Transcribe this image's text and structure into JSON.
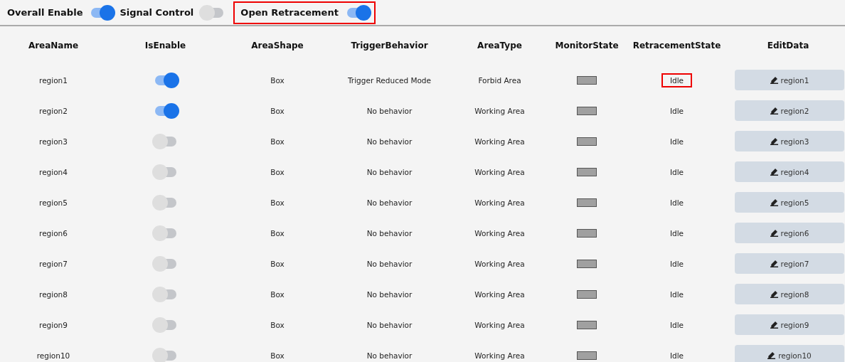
{
  "toolbar": [
    {
      "label": "Overall Enable",
      "on": true,
      "highlighted": false
    },
    {
      "label": "Signal Control",
      "on": false,
      "highlighted": false
    },
    {
      "label": "Open Retracement",
      "on": true,
      "highlighted": true
    }
  ],
  "table": {
    "columns": [
      "AreaName",
      "IsEnable",
      "AreaShape",
      "TriggerBehavior",
      "AreaType",
      "MonitorState",
      "RetracementState",
      "EditData"
    ],
    "rows": [
      {
        "name": "region1",
        "enabled": true,
        "shape": "Box",
        "trigger": "Trigger Reduced Mode",
        "type": "Forbid Area",
        "retracement": "Idle",
        "highlighted": true,
        "edit": "region1"
      },
      {
        "name": "region2",
        "enabled": true,
        "shape": "Box",
        "trigger": "No behavior",
        "type": "Working Area",
        "retracement": "Idle",
        "highlighted": false,
        "edit": "region2"
      },
      {
        "name": "region3",
        "enabled": false,
        "shape": "Box",
        "trigger": "No behavior",
        "type": "Working Area",
        "retracement": "Idle",
        "highlighted": false,
        "edit": "region3"
      },
      {
        "name": "region4",
        "enabled": false,
        "shape": "Box",
        "trigger": "No behavior",
        "type": "Working Area",
        "retracement": "Idle",
        "highlighted": false,
        "edit": "region4"
      },
      {
        "name": "region5",
        "enabled": false,
        "shape": "Box",
        "trigger": "No behavior",
        "type": "Working Area",
        "retracement": "Idle",
        "highlighted": false,
        "edit": "region5"
      },
      {
        "name": "region6",
        "enabled": false,
        "shape": "Box",
        "trigger": "No behavior",
        "type": "Working Area",
        "retracement": "Idle",
        "highlighted": false,
        "edit": "region6"
      },
      {
        "name": "region7",
        "enabled": false,
        "shape": "Box",
        "trigger": "No behavior",
        "type": "Working Area",
        "retracement": "Idle",
        "highlighted": false,
        "edit": "region7"
      },
      {
        "name": "region8",
        "enabled": false,
        "shape": "Box",
        "trigger": "No behavior",
        "type": "Working Area",
        "retracement": "Idle",
        "highlighted": false,
        "edit": "region8"
      },
      {
        "name": "region9",
        "enabled": false,
        "shape": "Box",
        "trigger": "No behavior",
        "type": "Working Area",
        "retracement": "Idle",
        "highlighted": false,
        "edit": "region9"
      },
      {
        "name": "region10",
        "enabled": false,
        "shape": "Box",
        "trigger": "No behavior",
        "type": "Working Area",
        "retracement": "Idle",
        "highlighted": false,
        "edit": "region10"
      }
    ]
  }
}
